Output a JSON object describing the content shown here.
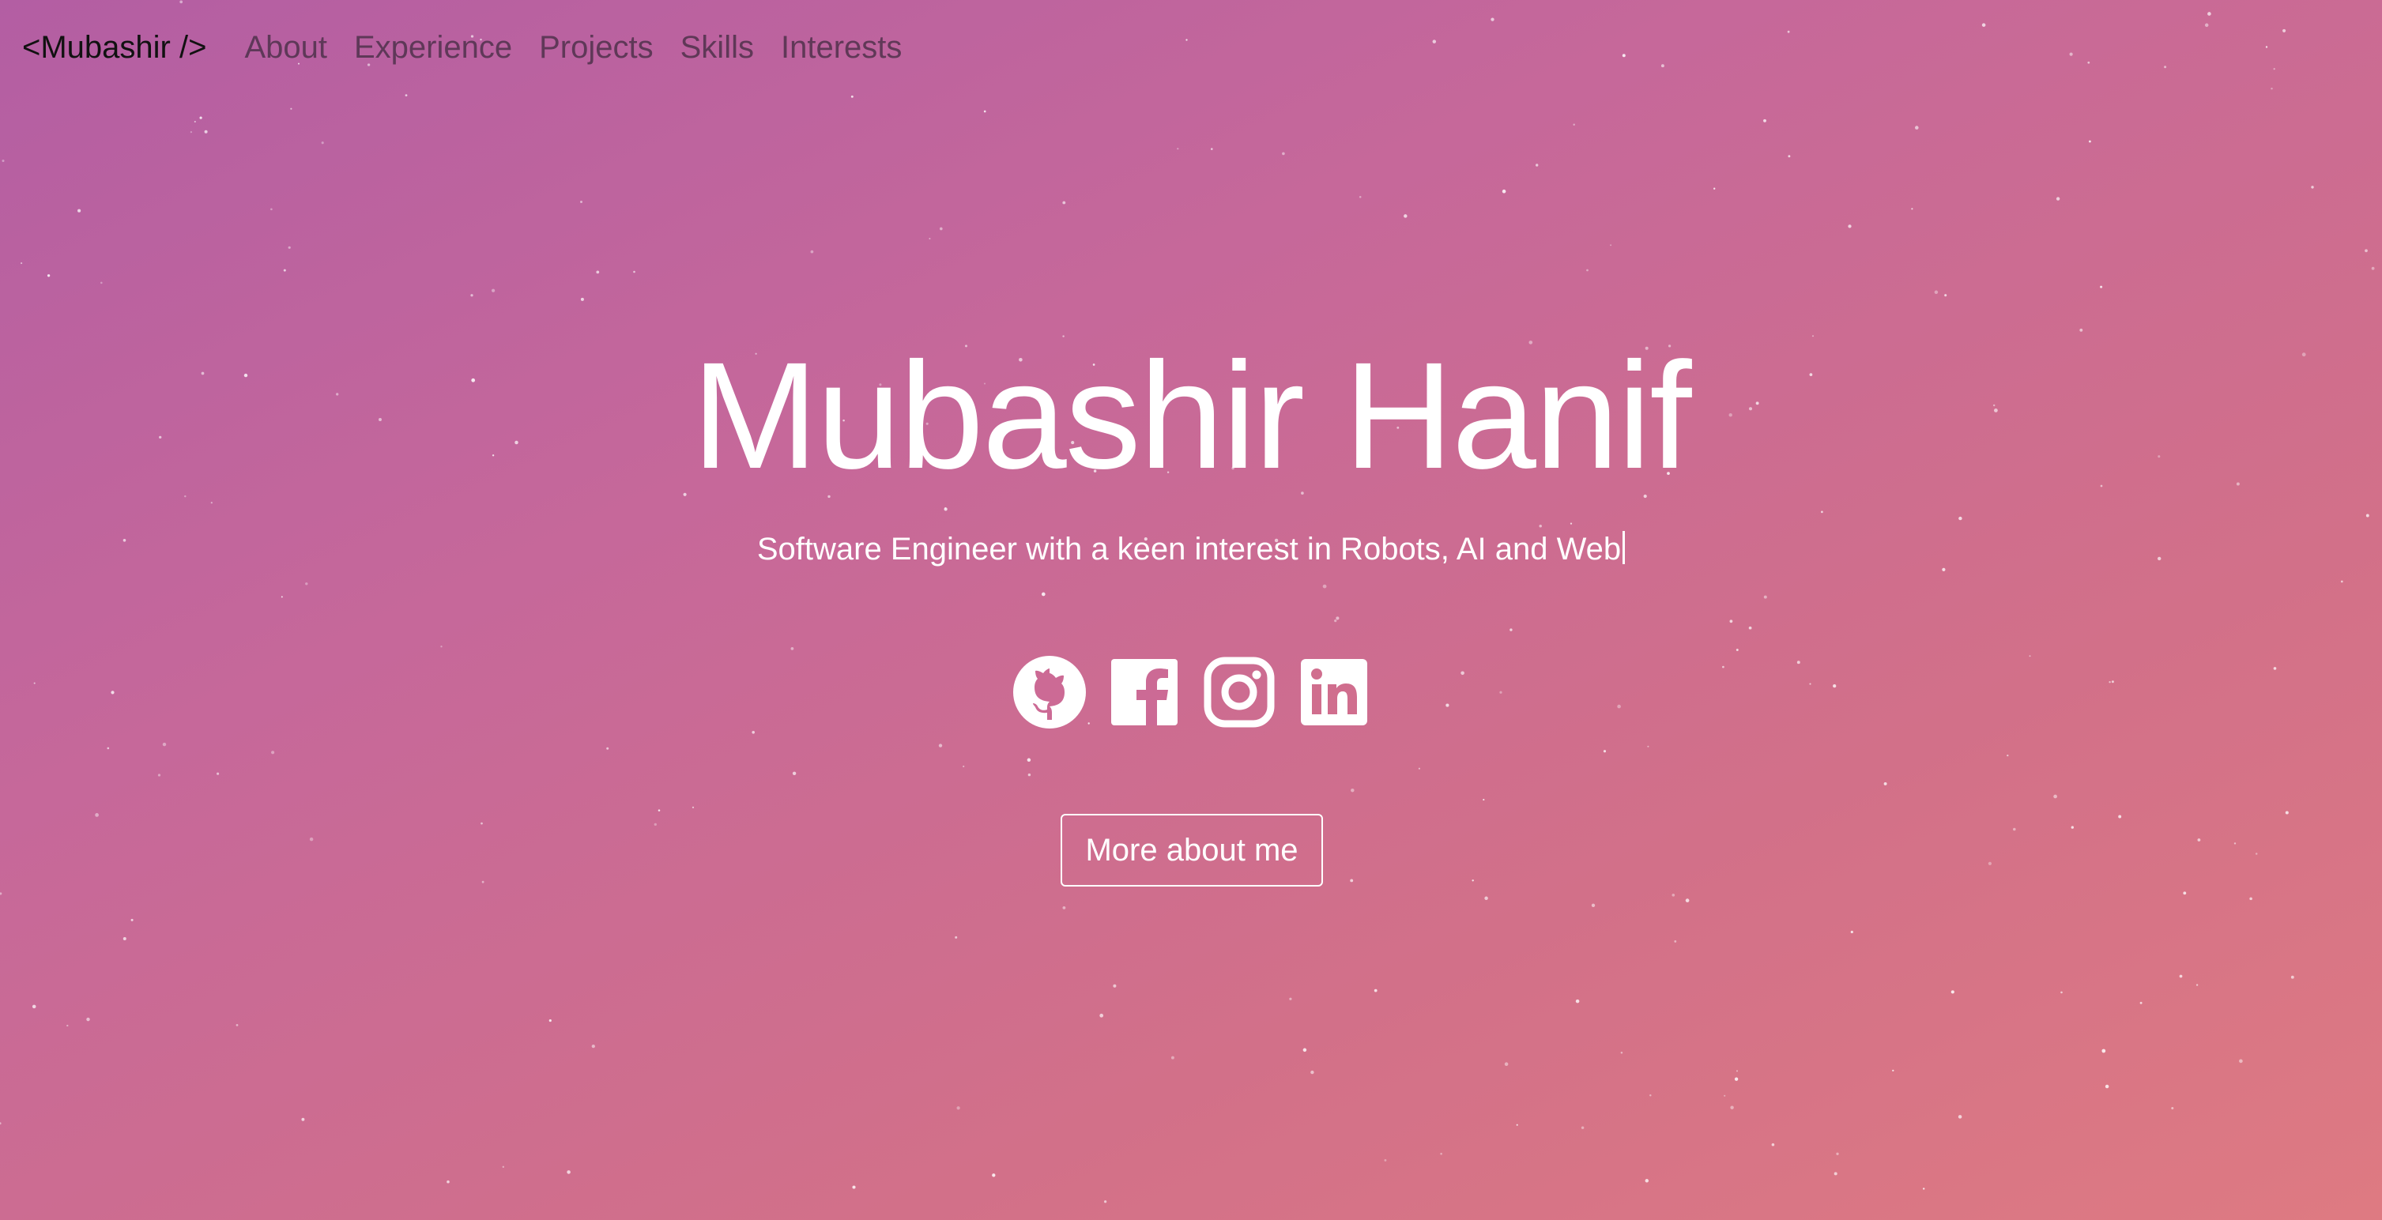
{
  "nav": {
    "brand": "<Mubashir />",
    "links": [
      "About",
      "Experience",
      "Projects",
      "Skills",
      "Interests"
    ]
  },
  "hero": {
    "name": "Mubashir Hanif",
    "subtitle": "Software Engineer with a keen interest in Robots, AI and Web"
  },
  "socials": [
    "github-icon",
    "facebook-icon",
    "instagram-icon",
    "linkedin-icon"
  ],
  "cta": {
    "label": "More about me"
  },
  "colors": {
    "gradient_start": "#b35ea3",
    "gradient_end": "#de7a82",
    "text": "#ffffff",
    "brand": "#111111"
  }
}
